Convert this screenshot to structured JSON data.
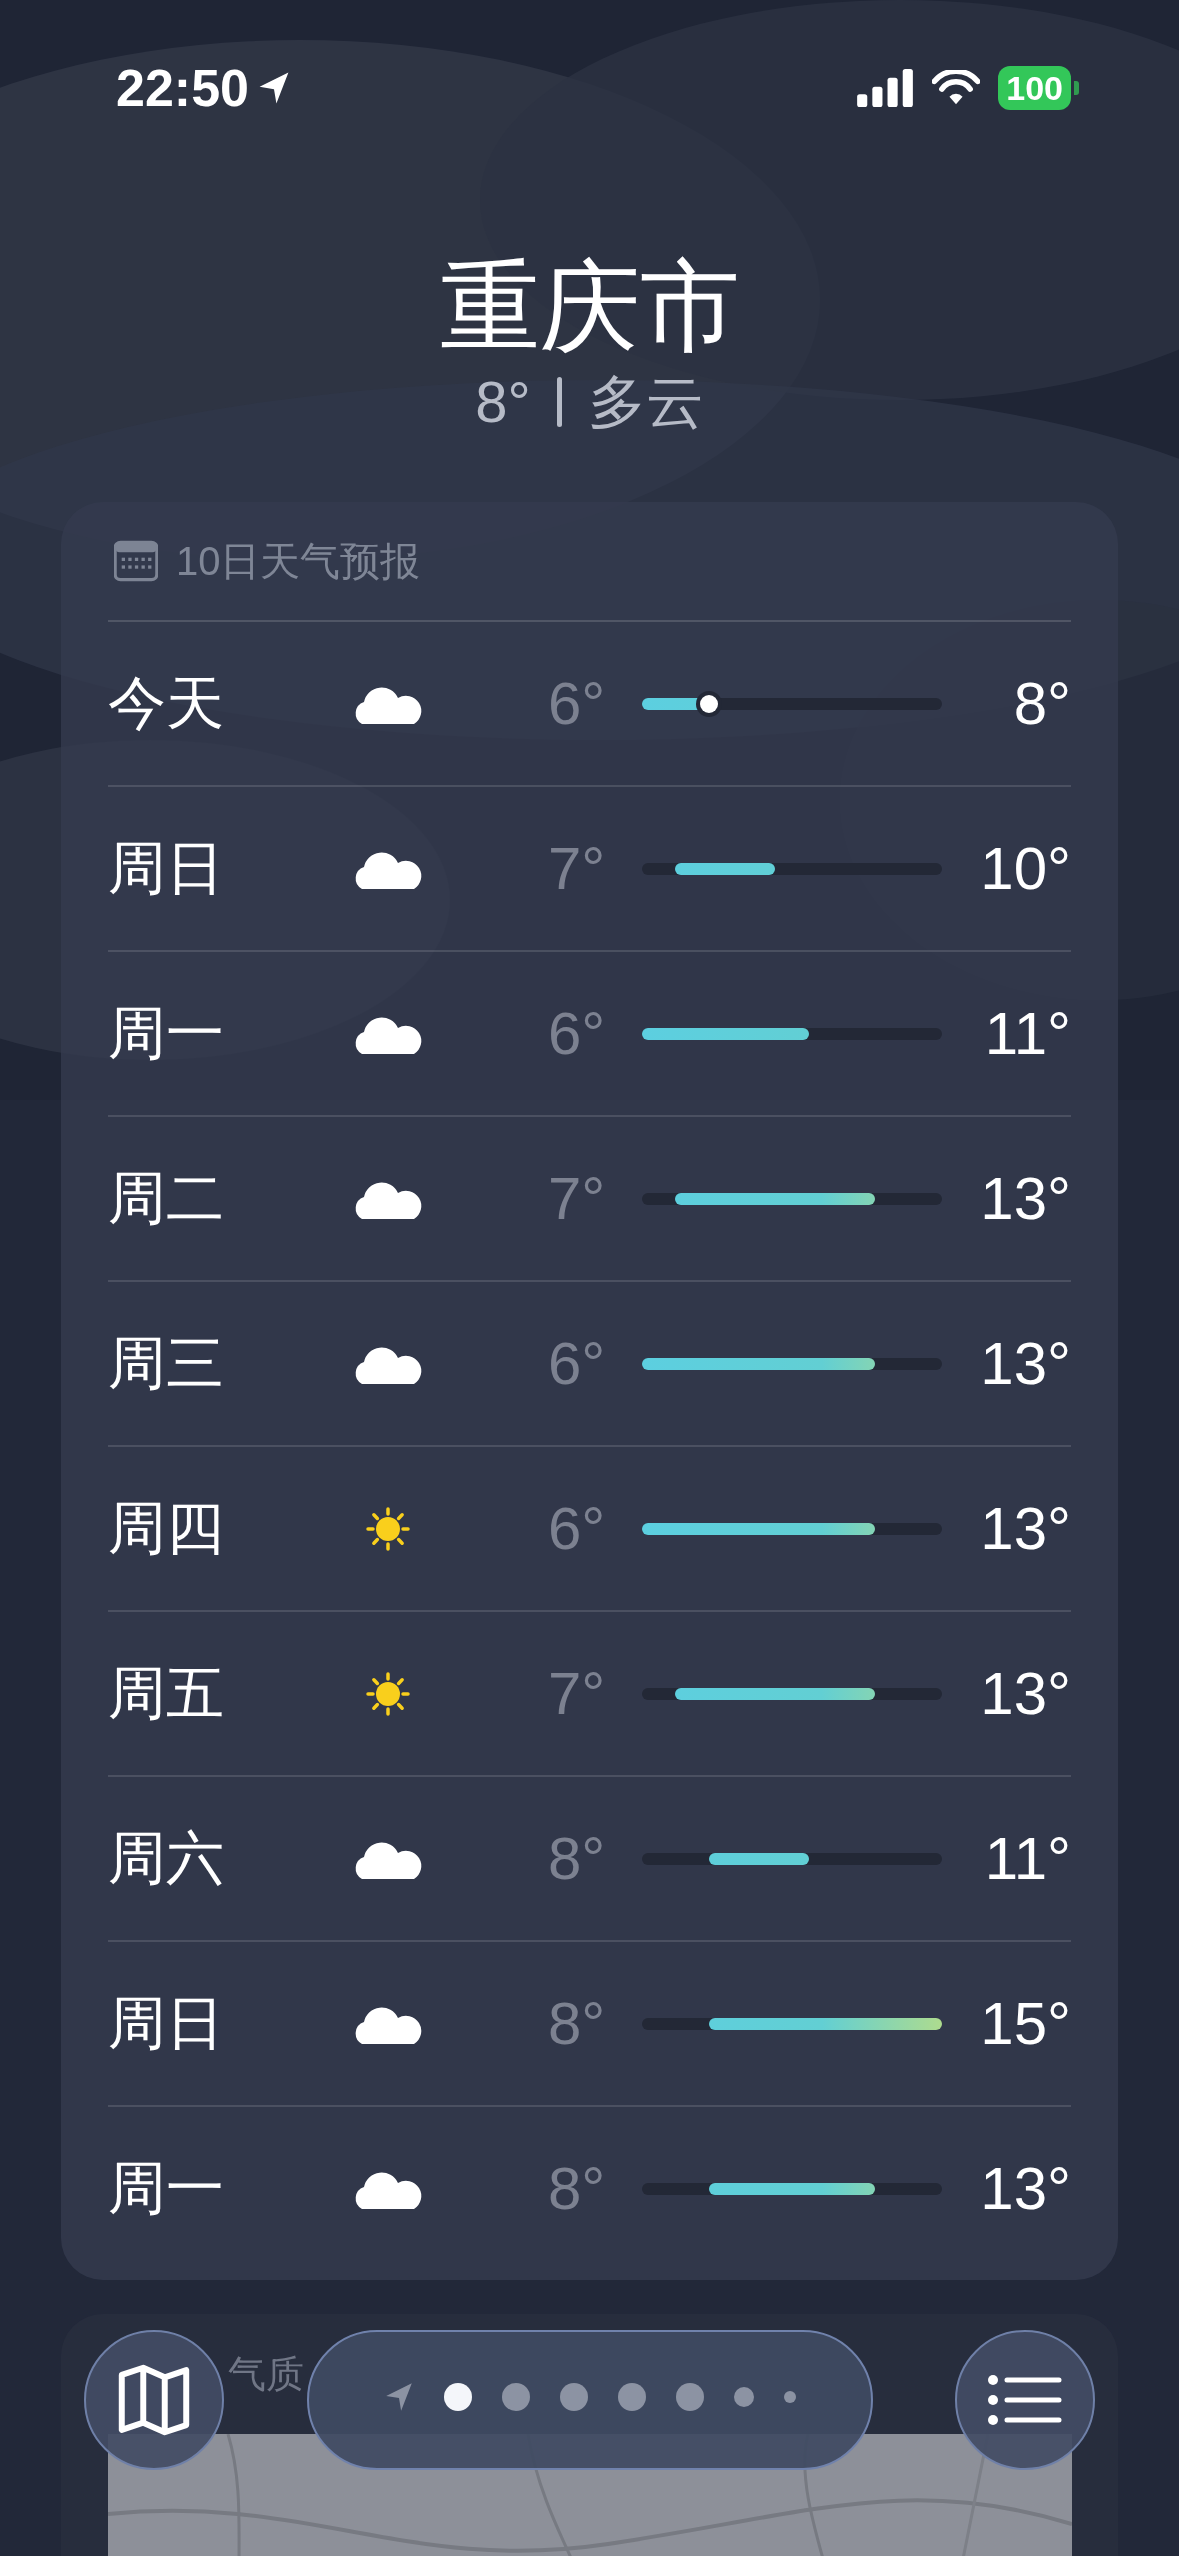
{
  "status_bar": {
    "time": "22:50",
    "battery": "100"
  },
  "header": {
    "city": "重庆市",
    "temperature": "8°",
    "condition": "多云"
  },
  "forecast": {
    "title": "10日天气预报",
    "days": [
      {
        "day": "今天",
        "kind": "cloudy",
        "low": "6°",
        "high": "8°",
        "current": true
      },
      {
        "day": "周日",
        "kind": "cloudy",
        "low": "7°",
        "high": "10°",
        "current": false
      },
      {
        "day": "周一",
        "kind": "cloudy",
        "low": "6°",
        "high": "11°",
        "current": false
      },
      {
        "day": "周二",
        "kind": "cloudy",
        "low": "7°",
        "high": "13°",
        "current": false
      },
      {
        "day": "周三",
        "kind": "cloudy",
        "low": "6°",
        "high": "13°",
        "current": false
      },
      {
        "day": "周四",
        "kind": "sunny",
        "low": "6°",
        "high": "13°",
        "current": false
      },
      {
        "day": "周五",
        "kind": "sunny",
        "low": "7°",
        "high": "13°",
        "current": false
      },
      {
        "day": "周六",
        "kind": "cloudy",
        "low": "8°",
        "high": "11°",
        "current": false
      },
      {
        "day": "周日",
        "kind": "cloudy",
        "low": "8°",
        "high": "15°",
        "current": false
      },
      {
        "day": "周一",
        "kind": "cloudy",
        "low": "8°",
        "high": "13°",
        "current": false
      }
    ]
  },
  "air_quality": {
    "title": "气质",
    "kind": "picture"
  },
  "page_dots": [
    {
      "kind": "location",
      "selected": false
    },
    {
      "kind": "dot",
      "selected": true
    },
    {
      "kind": "dot",
      "selected": false
    },
    {
      "kind": "dot",
      "selected": false
    },
    {
      "kind": "dot",
      "selected": false
    },
    {
      "kind": "dot",
      "selected": false
    },
    {
      "kind": "small",
      "selected": false
    },
    {
      "kind": "tiny",
      "selected": false
    }
  ]
}
